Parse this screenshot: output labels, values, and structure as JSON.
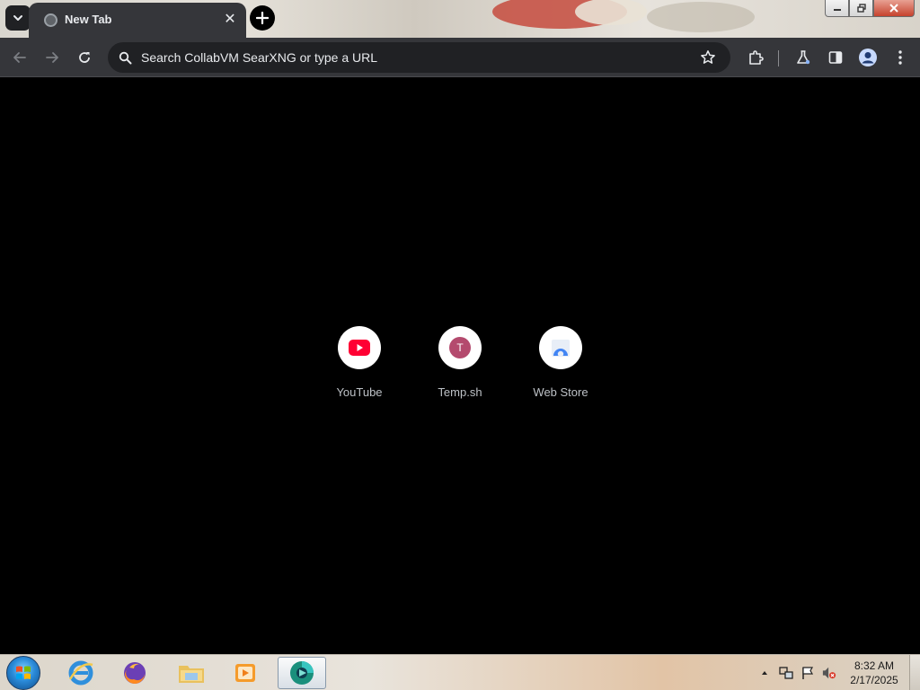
{
  "tab": {
    "title": "New Tab",
    "close_label": "✕"
  },
  "omnibox": {
    "placeholder": "Search CollabVM SearXNG or type a URL"
  },
  "shortcuts": [
    {
      "label": "YouTube",
      "color": "#ff0033"
    },
    {
      "label": "Temp.sh",
      "letter": "T",
      "color": "#b44a6e"
    },
    {
      "label": "Web Store",
      "color": "#4285f4"
    }
  ],
  "taskbar": {
    "apps": [
      "internet-explorer-icon",
      "firefox-icon",
      "file-explorer-icon",
      "media-player-icon",
      "browser-icon"
    ],
    "clock": {
      "time": "8:32 AM",
      "date": "2/17/2025"
    }
  },
  "colors": {
    "toolbar": "#35363a",
    "omnibox": "#202124",
    "content": "#000000",
    "text": "#e8eaed",
    "label": "#bdc1c6"
  }
}
